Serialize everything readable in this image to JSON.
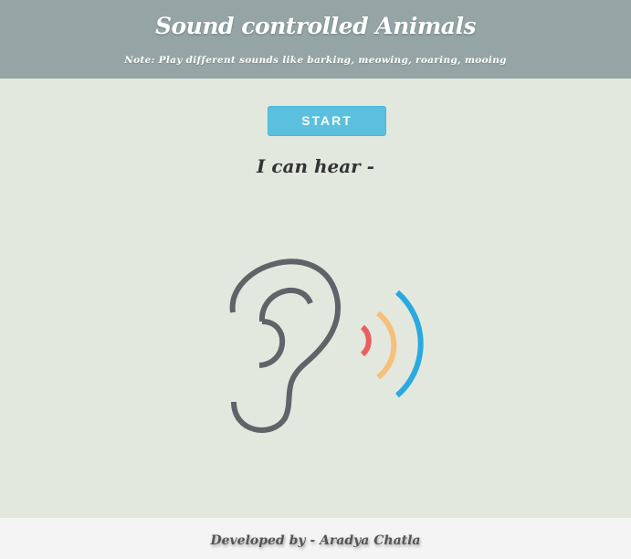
{
  "header": {
    "title": "Sound controlled Animals",
    "note": "Note: Play different sounds like barking, meowing, roaring, mooing"
  },
  "main": {
    "start_label": "START",
    "hear_label": "I can hear -"
  },
  "illustration": {
    "icon": "ear-listening-icon",
    "colors": {
      "ear": "#5e6468",
      "wave_inner": "#e95f5f",
      "wave_middle": "#f7c07a",
      "wave_outer": "#2aa9e0"
    }
  },
  "footer": {
    "credit": "Developed by - Aradya Chatla"
  },
  "colors": {
    "header_bg": "#95a5a5",
    "page_bg": "#e3e8de",
    "button_bg": "#5bc0de",
    "footer_bg": "#f4f4f4"
  }
}
